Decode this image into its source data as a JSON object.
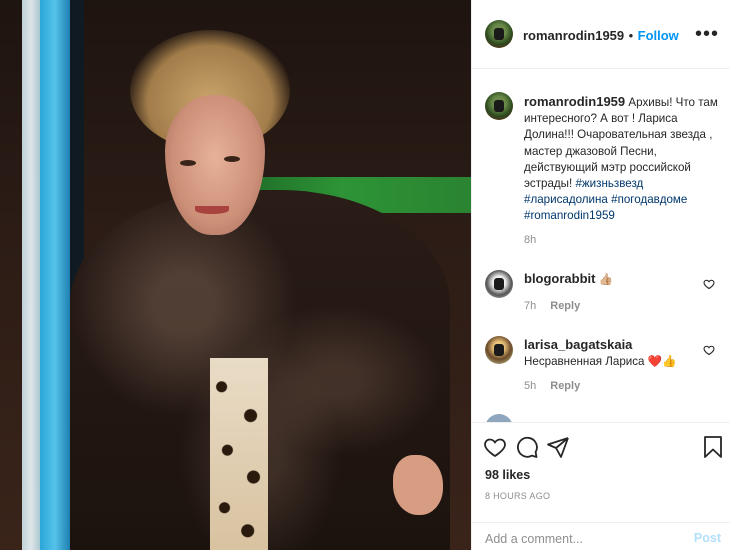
{
  "post": {
    "username": "romanrodin1959",
    "follow_label": "Follow",
    "separator": "•",
    "more_label": "•••"
  },
  "caption": {
    "username": "romanrodin1959",
    "text": "Архивы! Что там интересного? А вот ! Лариса Долина!!! Очаровательная звезда , мастер джазовой Песни, действующий мэтр российской эстрады! ",
    "hashtags": [
      "#жизньзвезд",
      "#ларисадолина",
      "#погодавдоме",
      "#romanrodin1959"
    ],
    "time": "8h"
  },
  "comments": [
    {
      "username": "blogorabbit",
      "text": "👍🏼",
      "time": "7h",
      "reply_label": "Reply"
    },
    {
      "username": "larisa_bagatskaia",
      "text": "Несравненная Лариса ❤️👍",
      "time": "5h",
      "reply_label": "Reply"
    }
  ],
  "actions": {
    "icons": [
      "heart-icon",
      "comment-icon",
      "share-icon",
      "bookmark-icon"
    ]
  },
  "likes": "98 likes",
  "timestamp": "8 HOURS AGO",
  "add_comment": {
    "placeholder": "Add a comment...",
    "post_label": "Post"
  },
  "colors": {
    "link": "#0095f6",
    "hashtag": "#00376b",
    "muted": "#8e8e8e",
    "text": "#262626"
  }
}
